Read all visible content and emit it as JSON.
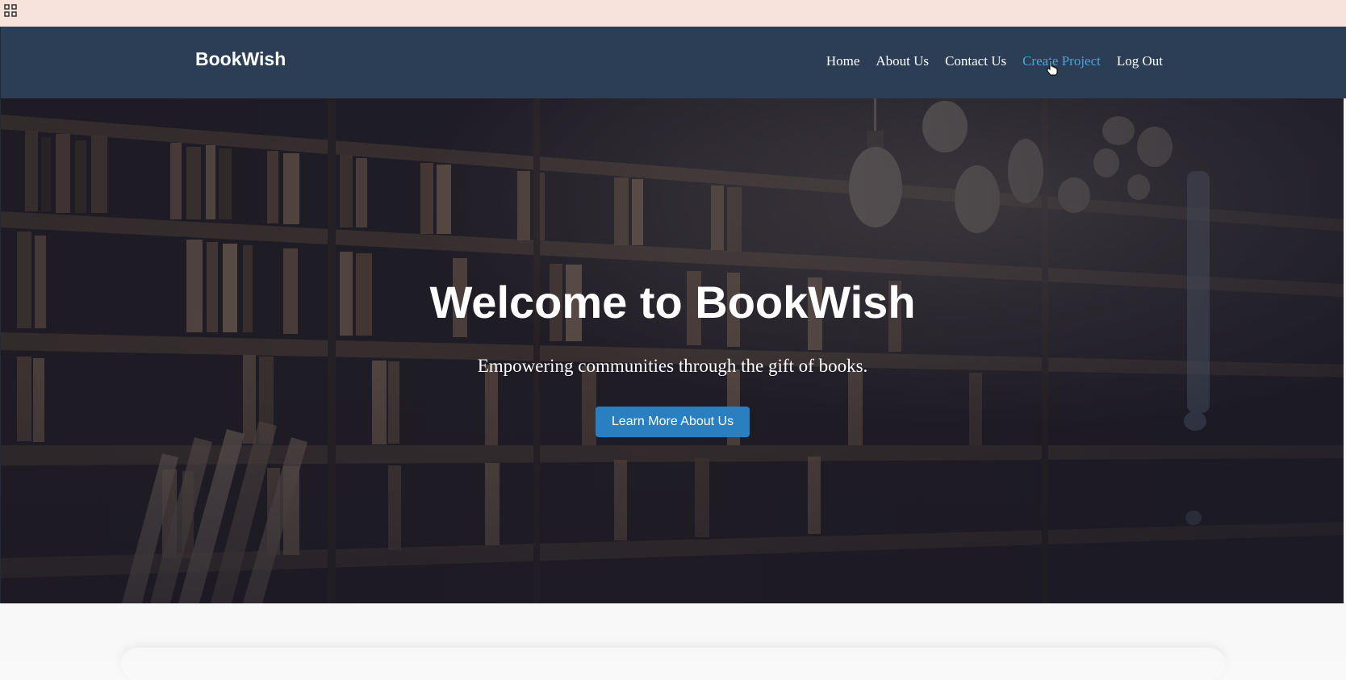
{
  "browser": {
    "apps_icon": "grid-apps-icon"
  },
  "navbar": {
    "brand": "BookWish",
    "links": [
      {
        "label": "Home",
        "active": false
      },
      {
        "label": "About Us",
        "active": false
      },
      {
        "label": "Contact Us",
        "active": false
      },
      {
        "label": "Create Project",
        "active": true
      },
      {
        "label": "Log Out",
        "active": false
      }
    ],
    "background_color": "#2c3e55",
    "active_color": "#4aa3df"
  },
  "hero": {
    "title": "Welcome to BookWish",
    "subtitle": "Empowering communities through the gift of books.",
    "button_label": "Learn More About Us",
    "button_color": "#2a7fc0",
    "background_image": "library-bookshelves-photo"
  },
  "cursor": "hand-pointer-icon"
}
